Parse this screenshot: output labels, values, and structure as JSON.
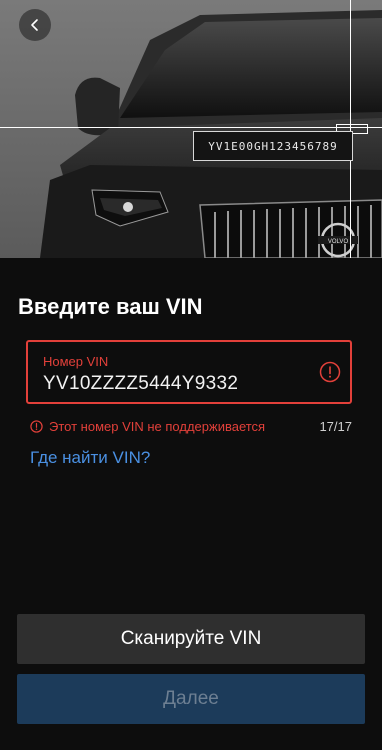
{
  "hero": {
    "vin_plate_text": "YV1E00GH123456789",
    "logo_text": "VOLVO"
  },
  "form": {
    "title": "Введите ваш VIN",
    "vin_label": "Номер VIN",
    "vin_value": "YV10ZZZZ5444Y9332",
    "error_message": "Этот номер VIN не поддерживается",
    "char_counter": "17/17",
    "help_link": "Где найти VIN?"
  },
  "actions": {
    "scan_label": "Сканируйте VIN",
    "next_label": "Далее"
  },
  "colors": {
    "background": "#0d0d0d",
    "error": "#e2403a",
    "link": "#4a90e2",
    "secondary_button": "#2f2f2f",
    "primary_button_disabled": "#1c3b5a"
  },
  "icons": {
    "back": "chevron-left-icon",
    "field_error": "error-circle-icon",
    "error": "error-circle-icon"
  }
}
